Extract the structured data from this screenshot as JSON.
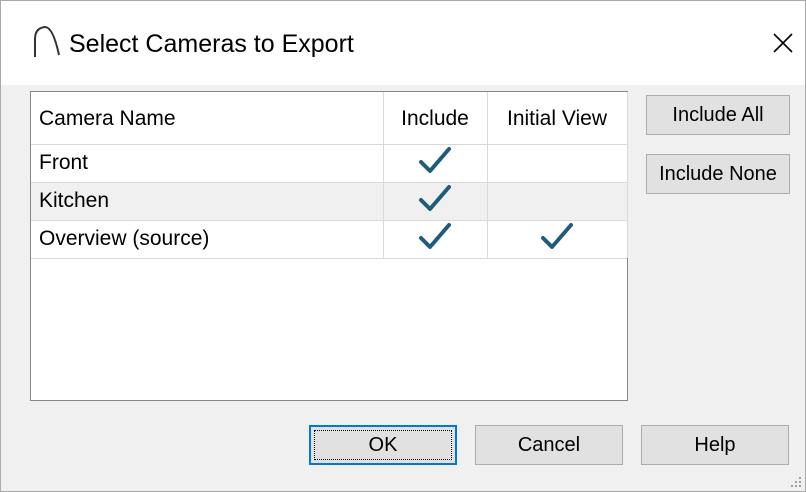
{
  "window": {
    "title": "Select Cameras to Export",
    "app_icon": "arc-icon",
    "close_icon": "close-icon"
  },
  "table": {
    "headers": {
      "name": "Camera Name",
      "include": "Include",
      "initial_view": "Initial View"
    },
    "rows": [
      {
        "name": "Front",
        "include": true,
        "initial_view": false
      },
      {
        "name": "Kitchen",
        "include": true,
        "initial_view": false
      },
      {
        "name": "Overview (source)",
        "include": true,
        "initial_view": true
      }
    ],
    "check_color": "#1f5c7a"
  },
  "buttons": {
    "include_all": "Include All",
    "include_none": "Include None",
    "ok": "OK",
    "cancel": "Cancel",
    "help": "Help"
  },
  "colors": {
    "accent": "#0078d7"
  }
}
